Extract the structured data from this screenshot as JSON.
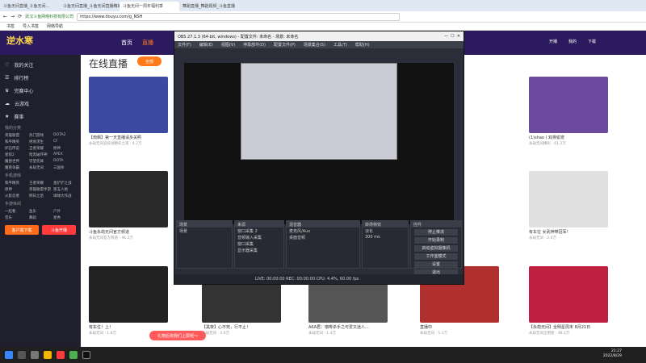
{
  "browser": {
    "tabs": [
      "斗鱼无间直播_斗鱼无间...",
      "斗鱼无间直播_斗鱼无间直播精彩视频...",
      "斗鱼无间一周年福利季",
      "舞蹈直播_舞蹈视频_斗鱼直播"
    ],
    "url": "https://www.douyu.com/g_NSH",
    "site_label": "武汉斗鱼网络科技有限公司",
    "bookmarks": [
      "书签",
      "导入书签",
      "网络导航"
    ]
  },
  "site": {
    "logo": "逆水寒",
    "nav": [
      "首页",
      "直播",
      "分类",
      "排行"
    ],
    "header_right": [
      "开播",
      "我的",
      "下载"
    ],
    "live_title": "在线直播",
    "all_btn": "全部"
  },
  "sidebar": {
    "items": [
      "我的关注",
      "排行榜",
      "完赛中心",
      "云游戏",
      "赛事"
    ],
    "sec1": "我的分类",
    "games1": [
      "英雄联盟",
      "热门游戏",
      "DOTA2",
      "和平精英",
      "绝地求生",
      "CF",
      "炉石传说",
      "王者荣耀",
      "原神",
      "星际2",
      "暗黑破坏神",
      "APEX",
      "魔兽世界",
      "守望先锋",
      "DOTA",
      "魔兽争霸",
      "永劫无间",
      "三国杀"
    ],
    "sec2": "手机游戏",
    "games2": [
      "和平精英",
      "王者荣耀",
      "金铲铲之战",
      "原神",
      "英雄联盟手游",
      "第五人格",
      "火影忍者",
      "明日之后",
      "球球大作战"
    ],
    "sec3": "手游休闲",
    "games3": [
      "一起看",
      "鱼乐",
      "户外",
      "音乐",
      "舞蹈",
      "星秀"
    ],
    "btn_left": "客户端下载",
    "btn_right": "斗鱼开播"
  },
  "cards": [
    {
      "title": "【南枫】第一天直播请多关照",
      "sub": "永劫无间竞技场精彩之夜",
      "count": "4.2万"
    },
    {
      "title": "斗鱼永劫无间官方频道",
      "sub": "永劫无间官方频道",
      "count": "46.2万"
    },
    {
      "title": "有车位！上！",
      "sub": "永劫无间",
      "count": "1.8万"
    },
    {
      "title": "(1)shao丨双排偷宠",
      "sub": "永劫无间精彩",
      "count": "61.2万"
    },
    {
      "title": "有车位 女武神带冠军！",
      "sub": "永劫无间",
      "count": "2.6万"
    },
    {
      "title": "【永劫无间】全明星周末 8月21日",
      "sub": "永劫无间全明星",
      "count": "48.2万"
    },
    {
      "title": "【黑夜】心不死，行不止！",
      "sub": "永劫无间",
      "count": "3.6万"
    },
    {
      "title": "AKA君：咖啡杀手之可爱又迷人...",
      "sub": "永劫无间",
      "count": "1.4万"
    },
    {
      "title": "直播中",
      "sub": "永劫无间",
      "count": "5.1万"
    }
  ],
  "obs": {
    "title": "OBS 27.1.3 (64-bit, windows) - 配置文件: 未命名 - 场景: 未命名",
    "menus": [
      "文件(F)",
      "编辑(E)",
      "视图(V)",
      "停靠部件(D)",
      "配置文件(P)",
      "场景集合(S)",
      "工具(T)",
      "帮助(H)"
    ],
    "docks": [
      {
        "name": "场景",
        "rows": [
          "场景"
        ]
      },
      {
        "name": "来源",
        "rows": [
          "窗口采集 2",
          "音频输入采集",
          "窗口采集",
          "显示器采集"
        ]
      },
      {
        "name": "混音器",
        "rows": [
          "麦克风/Aux",
          "桌面音频"
        ]
      },
      {
        "name": "转场特效",
        "rows": [
          "淡化",
          "300 ms"
        ]
      },
      {
        "name": "控件",
        "rows": [
          "停止推流",
          "开始录制",
          "启动虚拟摄像机",
          "工作室模式",
          "设置",
          "退出"
        ]
      }
    ],
    "status": "LIVE: 00:00:00    REC: 00:00:00    CPU: 4.4%, 60.00 fps"
  },
  "toast": "礼物后将我们上屏呢～",
  "taskbar": {
    "time": "21:27",
    "date": "2022/8/29"
  }
}
